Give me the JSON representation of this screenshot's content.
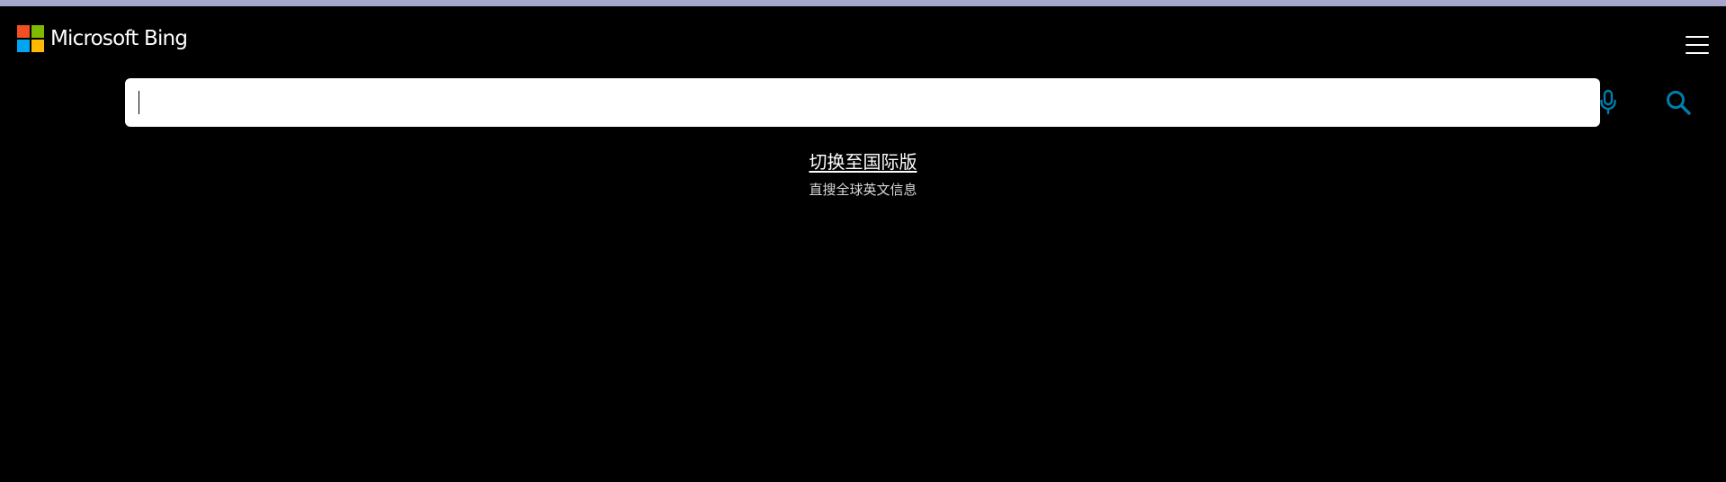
{
  "header": {
    "logo_text": "Microsoft Bing",
    "logo_colors": [
      "#f25022",
      "#7fba00",
      "#00a4ef",
      "#ffb900"
    ],
    "top_strip_color": "#a5a6cd",
    "menu_icon": "hamburger-menu-icon"
  },
  "search": {
    "value": "",
    "placeholder": "",
    "mic_icon": "microphone-icon",
    "search_icon": "search-icon",
    "icon_color": "#007daa"
  },
  "main": {
    "switch_link": "切换至国际版",
    "switch_sub": "直搜全球英文信息"
  }
}
